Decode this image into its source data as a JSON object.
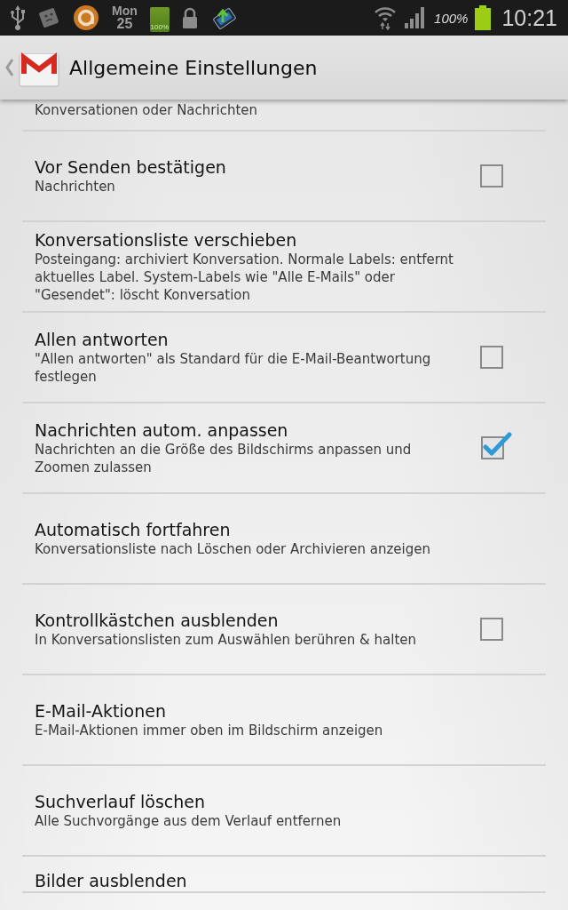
{
  "status_bar": {
    "day": "Mon",
    "date": "25",
    "widget_battery_label": "100%",
    "battery_percent": "100%",
    "time": "10:21"
  },
  "action_bar": {
    "title": "Allgemeine Einstellungen"
  },
  "settings": [
    {
      "kind": "plain",
      "summary": "Konversationen oder Nachrichten"
    },
    {
      "kind": "checkbox",
      "title": "Vor Senden bestätigen",
      "summary": "Nachrichten",
      "checked": false
    },
    {
      "kind": "plain",
      "title": "Konversationsliste verschieben",
      "summary": "Posteingang: archiviert Konversation. Normale Labels: entfernt aktuelles Label. System-Labels wie \"Alle E-Mails\" oder \"Gesendet\": löscht Konversation"
    },
    {
      "kind": "checkbox",
      "title": "Allen antworten",
      "summary": "\"Allen antworten\" als Standard für die E-Mail-Beantwortung festlegen",
      "checked": false
    },
    {
      "kind": "checkbox",
      "title": "Nachrichten autom. anpassen",
      "summary": "Nachrichten an die Größe des Bildschirms anpassen und Zoomen zulassen",
      "checked": true
    },
    {
      "kind": "plain",
      "title": "Automatisch fortfahren",
      "summary": "Konversationsliste nach Löschen oder Archivieren anzeigen"
    },
    {
      "kind": "checkbox",
      "title": "Kontrollkästchen ausblenden",
      "summary": "In Konversationslisten zum Auswählen berühren & halten",
      "checked": false
    },
    {
      "kind": "plain",
      "title": "E-Mail-Aktionen",
      "summary": "E-Mail-Aktionen immer oben im Bildschirm anzeigen"
    },
    {
      "kind": "plain",
      "title": "Suchverlauf löschen",
      "summary": "Alle Suchvorgänge aus dem Verlauf entfernen"
    },
    {
      "kind": "plain",
      "title": "Bilder ausblenden"
    }
  ]
}
